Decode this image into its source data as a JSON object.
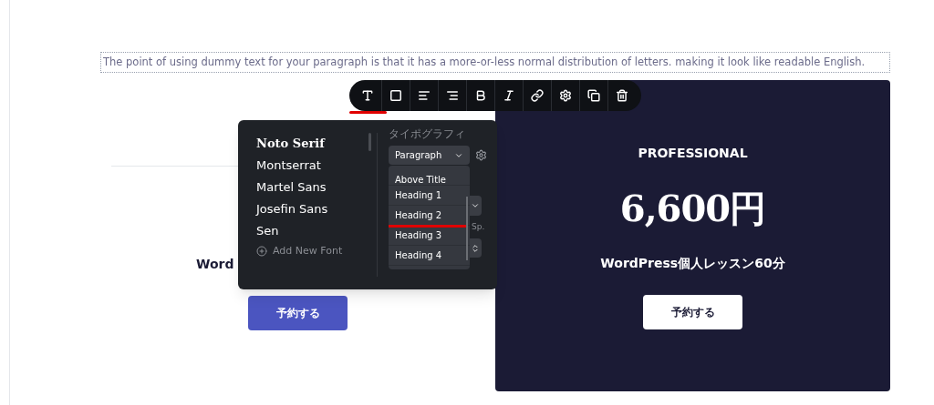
{
  "paragraph": "The point of using dummy text for your paragraph is that it has a more-or-less normal distribution of letters. making it look like readable English.",
  "toolbar": {
    "tools": [
      {
        "kind": "text",
        "selected": true
      },
      {
        "kind": "box",
        "selected": false
      },
      {
        "kind": "align-left",
        "selected": false
      },
      {
        "kind": "align-right",
        "selected": false
      },
      {
        "kind": "bold",
        "selected": false
      },
      {
        "kind": "italic",
        "selected": false
      },
      {
        "kind": "link",
        "selected": false
      },
      {
        "kind": "settings",
        "selected": false
      },
      {
        "kind": "copy",
        "selected": false
      },
      {
        "kind": "delete",
        "selected": false
      }
    ]
  },
  "font_panel": {
    "fonts": [
      {
        "name": "Noto Serif",
        "kind": "serif"
      },
      {
        "name": "Montserrat",
        "kind": "sans"
      },
      {
        "name": "Martel Sans",
        "kind": "sans"
      },
      {
        "name": "Josefin Sans",
        "kind": "sans"
      },
      {
        "name": "Sen",
        "kind": "sans"
      }
    ],
    "add_font": "Add New Font",
    "typography_label": "タイポグラフィ",
    "style_select": "Paragraph",
    "style_options": [
      {
        "label": "Above Title",
        "selected": false
      },
      {
        "label": "Heading 1",
        "selected": false
      },
      {
        "label": "Heading 2",
        "selected": true
      },
      {
        "label": "Heading 3",
        "selected": false
      },
      {
        "label": "Heading 4",
        "selected": false
      }
    ],
    "spacing_label": "Sp."
  },
  "plans": [
    {
      "description": "Word",
      "button": "予約する",
      "kind": "light"
    },
    {
      "name": "PROFESSIONAL",
      "price": "6,600円",
      "description": "WordPress個人レッスン60分",
      "button": "予約する",
      "kind": "dark"
    }
  ]
}
